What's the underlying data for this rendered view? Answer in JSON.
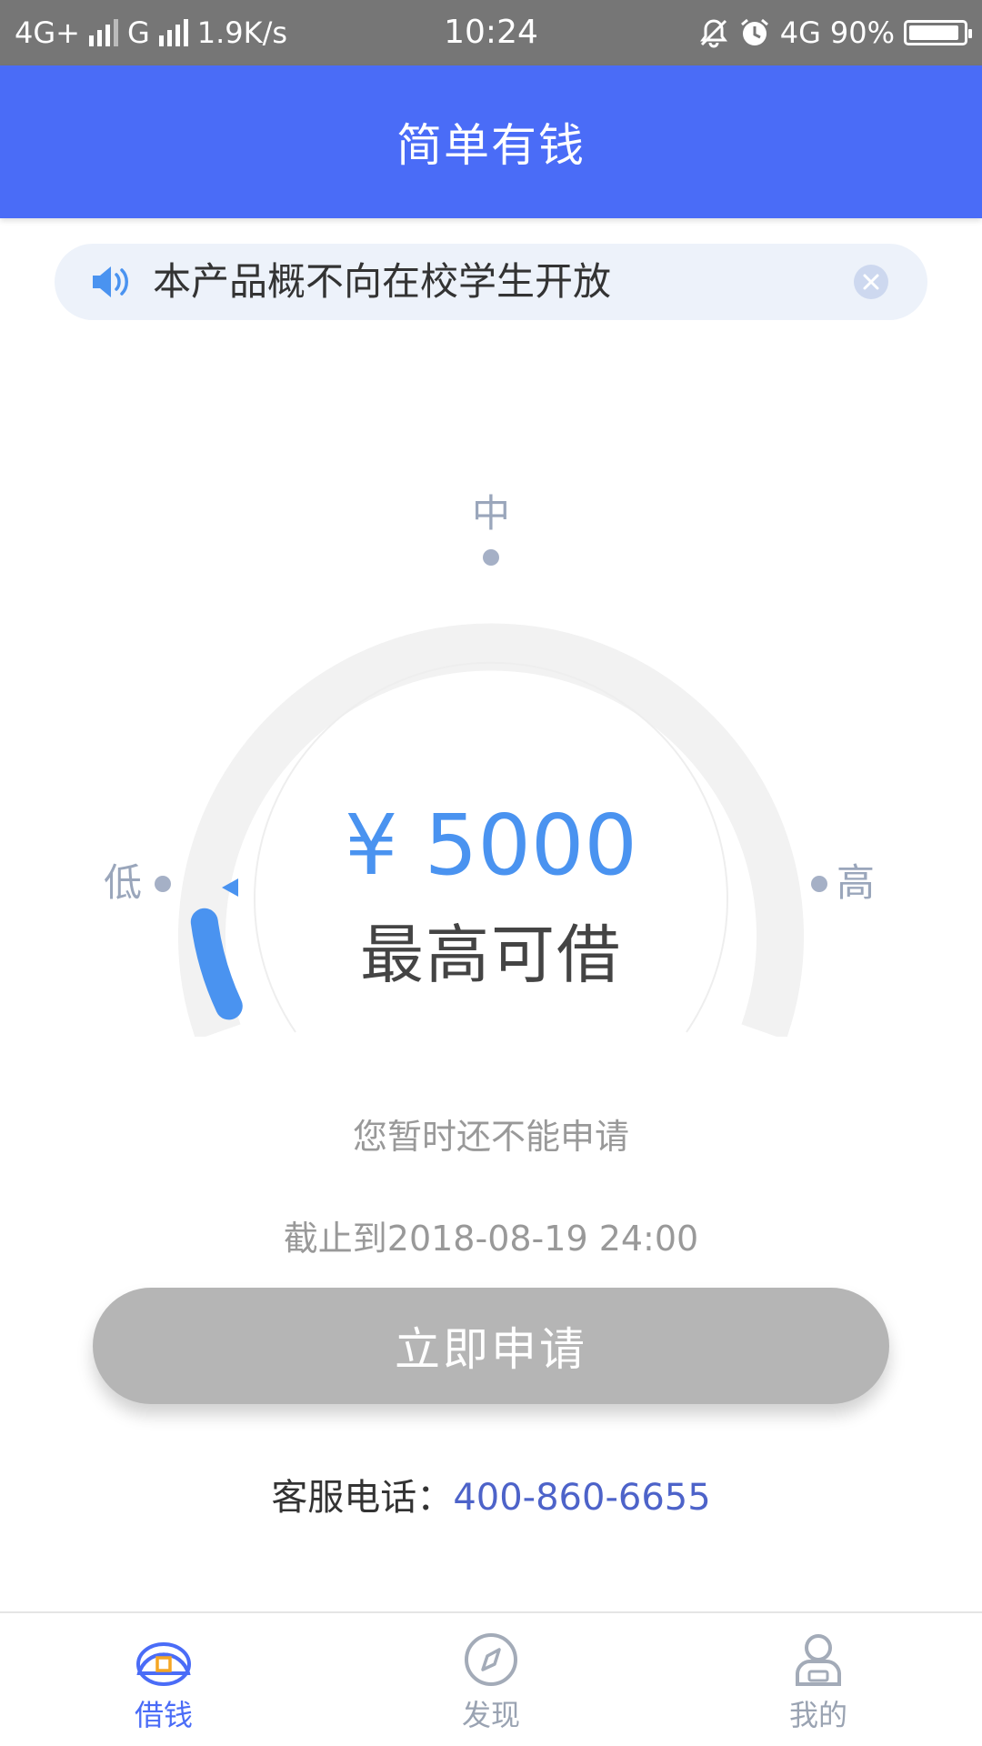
{
  "status_bar": {
    "network_left": "4G+",
    "network_second": "G",
    "speed": "1.9K/s",
    "time": "10:24",
    "network_right": "4G",
    "battery": "90%"
  },
  "header": {
    "title": "简单有钱"
  },
  "notice": {
    "text": "本产品概不向在校学生开放",
    "icon": "speaker-icon",
    "close_icon": "close-icon"
  },
  "gauge": {
    "label_low": "低",
    "label_mid": "中",
    "label_high": "高",
    "amount": "¥ 5000",
    "amount_caption": "最高可借",
    "level_fraction": 0.08,
    "accent_color": "#4a93f0",
    "track_color": "#f2f2f2"
  },
  "status": {
    "message": "您暂时还不能申请",
    "deadline": "截止到2018-08-19 24:00"
  },
  "apply_button": {
    "label": "立即申请"
  },
  "hotline": {
    "label": "客服电话：",
    "phone": "400-860-6655"
  },
  "bottom_nav": {
    "items": [
      {
        "label": "借钱",
        "icon": "borrow-icon",
        "active": true
      },
      {
        "label": "发现",
        "icon": "compass-icon",
        "active": false
      },
      {
        "label": "我的",
        "icon": "profile-icon",
        "active": false
      }
    ]
  },
  "colors": {
    "brand": "#4a6cf7",
    "amount": "#4a93f0",
    "button_disabled": "#b5b5b5",
    "phone_link": "#4d63c9"
  }
}
